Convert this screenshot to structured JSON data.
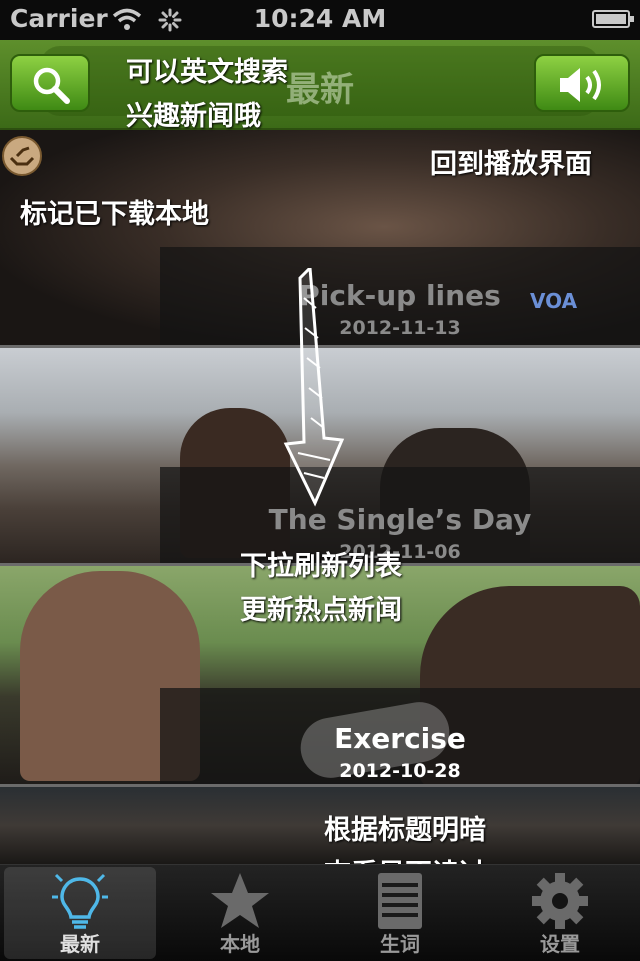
{
  "status_bar": {
    "carrier": "Carrier",
    "time": "10:24 AM"
  },
  "nav": {
    "title": "最新"
  },
  "annotations": {
    "search_line1": "可以英文搜索",
    "search_line2": "兴趣新闻哦",
    "back_to_player": "回到播放界面",
    "downloaded_mark": "标记已下载本地",
    "pull_refresh_line1": "下拉刷新列表",
    "pull_refresh_line2": "更新热点新闻",
    "read_hint_line1": "根据标题明暗",
    "read_hint_line2": "查看是否读过"
  },
  "news": [
    {
      "title": "Pick-up lines",
      "date": "2012-11-13",
      "read": true
    },
    {
      "title": "The Single’s Day",
      "date": "2012-11-06",
      "read": true
    },
    {
      "title": "Exercise",
      "date": "2012-10-28",
      "read": false
    }
  ],
  "tabs": [
    {
      "label": "最新",
      "icon": "lightbulb-icon",
      "selected": true
    },
    {
      "label": "本地",
      "icon": "star-icon",
      "selected": false
    },
    {
      "label": "生词",
      "icon": "notebook-icon",
      "selected": false
    },
    {
      "label": "设置",
      "icon": "gear-icon",
      "selected": false
    }
  ],
  "colors": {
    "nav_green": "#4e7d22",
    "button_green": "#6cc22e",
    "read_text": "#8a8a8a",
    "unread_text": "#ffffff"
  }
}
